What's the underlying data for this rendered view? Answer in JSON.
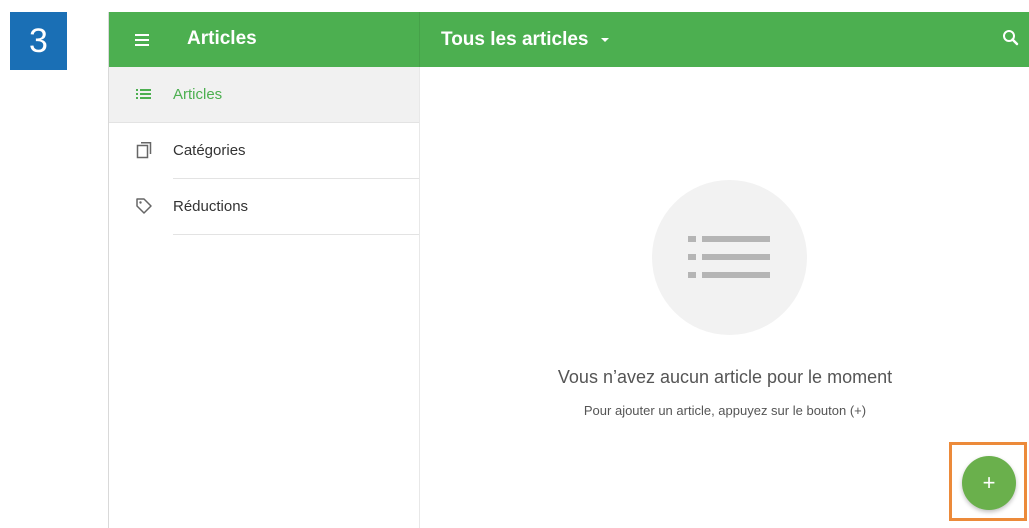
{
  "step_badge": {
    "label": "3",
    "color": "#1a6fb5"
  },
  "colors": {
    "accent": "#4caf50",
    "fab": "#6ab04c",
    "highlight": "#ec8a3a"
  },
  "topbar": {
    "menu_icon": "menu-icon",
    "title": "Articles",
    "filter_label": "Tous les articles",
    "filter_icon": "caret-down-icon",
    "search_icon": "search-icon"
  },
  "sidebar": {
    "items": [
      {
        "label": "Articles",
        "icon": "list-icon",
        "active": true
      },
      {
        "label": "Catégories",
        "icon": "copy-icon",
        "active": false
      },
      {
        "label": "Réductions",
        "icon": "tag-icon",
        "active": false
      }
    ]
  },
  "empty_state": {
    "icon": "list-icon",
    "title": "Vous n’avez aucun article pour le moment",
    "subtitle": "Pour ajouter un article, appuyez sur le bouton (+)"
  },
  "fab": {
    "label": "+",
    "icon": "plus-icon"
  }
}
